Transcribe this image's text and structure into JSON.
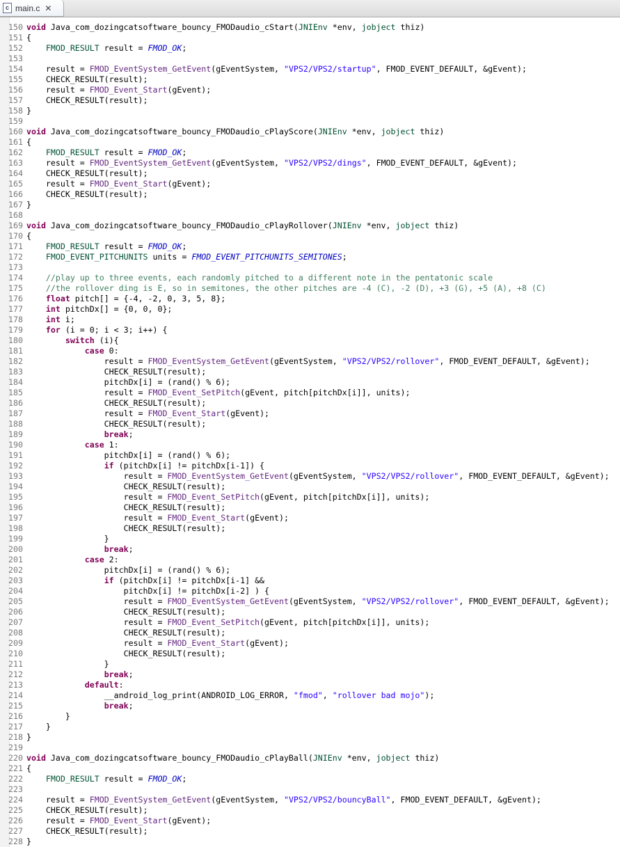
{
  "tab": {
    "label": "main.c",
    "icon": "c-file-icon"
  },
  "code_lines": [
    {
      "n": "150",
      "t": "void Java_com_dozingcatsoftware_bouncy_FMODaudio_cStart(JNIEnv *env, jobject thiz)"
    },
    {
      "n": "151",
      "t": "{"
    },
    {
      "n": "152",
      "t": "    FMOD_RESULT result = FMOD_OK;"
    },
    {
      "n": "153",
      "t": ""
    },
    {
      "n": "154",
      "t": "    result = FMOD_EventSystem_GetEvent(gEventSystem, \"VPS2/VPS2/startup\", FMOD_EVENT_DEFAULT, &gEvent);"
    },
    {
      "n": "155",
      "t": "    CHECK_RESULT(result);"
    },
    {
      "n": "156",
      "t": "    result = FMOD_Event_Start(gEvent);"
    },
    {
      "n": "157",
      "t": "    CHECK_RESULT(result);"
    },
    {
      "n": "158",
      "t": "}"
    },
    {
      "n": "159",
      "t": ""
    },
    {
      "n": "160",
      "t": "void Java_com_dozingcatsoftware_bouncy_FMODaudio_cPlayScore(JNIEnv *env, jobject thiz)"
    },
    {
      "n": "161",
      "t": "{"
    },
    {
      "n": "162",
      "t": "    FMOD_RESULT result = FMOD_OK;"
    },
    {
      "n": "163",
      "t": "    result = FMOD_EventSystem_GetEvent(gEventSystem, \"VPS2/VPS2/dings\", FMOD_EVENT_DEFAULT, &gEvent);"
    },
    {
      "n": "164",
      "t": "    CHECK_RESULT(result);"
    },
    {
      "n": "165",
      "t": "    result = FMOD_Event_Start(gEvent);"
    },
    {
      "n": "166",
      "t": "    CHECK_RESULT(result);"
    },
    {
      "n": "167",
      "t": "}"
    },
    {
      "n": "168",
      "t": ""
    },
    {
      "n": "169",
      "t": "void Java_com_dozingcatsoftware_bouncy_FMODaudio_cPlayRollover(JNIEnv *env, jobject thiz)"
    },
    {
      "n": "170",
      "t": "{"
    },
    {
      "n": "171",
      "t": "    FMOD_RESULT result = FMOD_OK;"
    },
    {
      "n": "172",
      "t": "    FMOD_EVENT_PITCHUNITS units = FMOD_EVENT_PITCHUNITS_SEMITONES;"
    },
    {
      "n": "173",
      "t": ""
    },
    {
      "n": "174",
      "t": "    //play up to three events, each randomly pitched to a different note in the pentatonic scale"
    },
    {
      "n": "175",
      "t": "    //the rollover ding is E, so in semitones, the other pitches are -4 (C), -2 (D), +3 (G), +5 (A), +8 (C)"
    },
    {
      "n": "176",
      "t": "    float pitch[] = {-4, -2, 0, 3, 5, 8};"
    },
    {
      "n": "177",
      "t": "    int pitchDx[] = {0, 0, 0};"
    },
    {
      "n": "178",
      "t": "    int i;"
    },
    {
      "n": "179",
      "t": "    for (i = 0; i < 3; i++) {"
    },
    {
      "n": "180",
      "t": "        switch (i){"
    },
    {
      "n": "181",
      "t": "            case 0:"
    },
    {
      "n": "182",
      "t": "                result = FMOD_EventSystem_GetEvent(gEventSystem, \"VPS2/VPS2/rollover\", FMOD_EVENT_DEFAULT, &gEvent);"
    },
    {
      "n": "183",
      "t": "                CHECK_RESULT(result);"
    },
    {
      "n": "184",
      "t": "                pitchDx[i] = (rand() % 6);"
    },
    {
      "n": "185",
      "t": "                result = FMOD_Event_SetPitch(gEvent, pitch[pitchDx[i]], units);"
    },
    {
      "n": "186",
      "t": "                CHECK_RESULT(result);"
    },
    {
      "n": "187",
      "t": "                result = FMOD_Event_Start(gEvent);"
    },
    {
      "n": "188",
      "t": "                CHECK_RESULT(result);"
    },
    {
      "n": "189",
      "t": "                break;"
    },
    {
      "n": "190",
      "t": "            case 1:"
    },
    {
      "n": "191",
      "t": "                pitchDx[i] = (rand() % 6);"
    },
    {
      "n": "192",
      "t": "                if (pitchDx[i] != pitchDx[i-1]) {"
    },
    {
      "n": "193",
      "t": "                    result = FMOD_EventSystem_GetEvent(gEventSystem, \"VPS2/VPS2/rollover\", FMOD_EVENT_DEFAULT, &gEvent);"
    },
    {
      "n": "194",
      "t": "                    CHECK_RESULT(result);"
    },
    {
      "n": "195",
      "t": "                    result = FMOD_Event_SetPitch(gEvent, pitch[pitchDx[i]], units);"
    },
    {
      "n": "196",
      "t": "                    CHECK_RESULT(result);"
    },
    {
      "n": "197",
      "t": "                    result = FMOD_Event_Start(gEvent);"
    },
    {
      "n": "198",
      "t": "                    CHECK_RESULT(result);"
    },
    {
      "n": "199",
      "t": "                }"
    },
    {
      "n": "200",
      "t": "                break;"
    },
    {
      "n": "201",
      "t": "            case 2:"
    },
    {
      "n": "202",
      "t": "                pitchDx[i] = (rand() % 6);"
    },
    {
      "n": "203",
      "t": "                if (pitchDx[i] != pitchDx[i-1] &&"
    },
    {
      "n": "204",
      "t": "                    pitchDx[i] != pitchDx[i-2] ) {"
    },
    {
      "n": "205",
      "t": "                    result = FMOD_EventSystem_GetEvent(gEventSystem, \"VPS2/VPS2/rollover\", FMOD_EVENT_DEFAULT, &gEvent);"
    },
    {
      "n": "206",
      "t": "                    CHECK_RESULT(result);"
    },
    {
      "n": "207",
      "t": "                    result = FMOD_Event_SetPitch(gEvent, pitch[pitchDx[i]], units);"
    },
    {
      "n": "208",
      "t": "                    CHECK_RESULT(result);"
    },
    {
      "n": "209",
      "t": "                    result = FMOD_Event_Start(gEvent);"
    },
    {
      "n": "210",
      "t": "                    CHECK_RESULT(result);"
    },
    {
      "n": "211",
      "t": "                }"
    },
    {
      "n": "212",
      "t": "                break;"
    },
    {
      "n": "213",
      "t": "            default:"
    },
    {
      "n": "214",
      "t": "                __android_log_print(ANDROID_LOG_ERROR, \"fmod\", \"rollover bad mojo\");"
    },
    {
      "n": "215",
      "t": "                break;"
    },
    {
      "n": "216",
      "t": "        }"
    },
    {
      "n": "217",
      "t": "    }"
    },
    {
      "n": "218",
      "t": "}"
    },
    {
      "n": "219",
      "t": ""
    },
    {
      "n": "220",
      "t": "void Java_com_dozingcatsoftware_bouncy_FMODaudio_cPlayBall(JNIEnv *env, jobject thiz)"
    },
    {
      "n": "221",
      "t": "{"
    },
    {
      "n": "222",
      "t": "    FMOD_RESULT result = FMOD_OK;"
    },
    {
      "n": "223",
      "t": ""
    },
    {
      "n": "224",
      "t": "    result = FMOD_EventSystem_GetEvent(gEventSystem, \"VPS2/VPS2/bouncyBall\", FMOD_EVENT_DEFAULT, &gEvent);"
    },
    {
      "n": "225",
      "t": "    CHECK_RESULT(result);"
    },
    {
      "n": "226",
      "t": "    result = FMOD_Event_Start(gEvent);"
    },
    {
      "n": "227",
      "t": "    CHECK_RESULT(result);"
    },
    {
      "n": "228",
      "t": "}"
    }
  ],
  "colors": {
    "keyword": "#7f0055",
    "function_call": "#642880",
    "macro_constant": "#0000c0",
    "string": "#2a00ff",
    "comment": "#3f7f5f",
    "type": "#005032",
    "line_number": "#787878"
  }
}
